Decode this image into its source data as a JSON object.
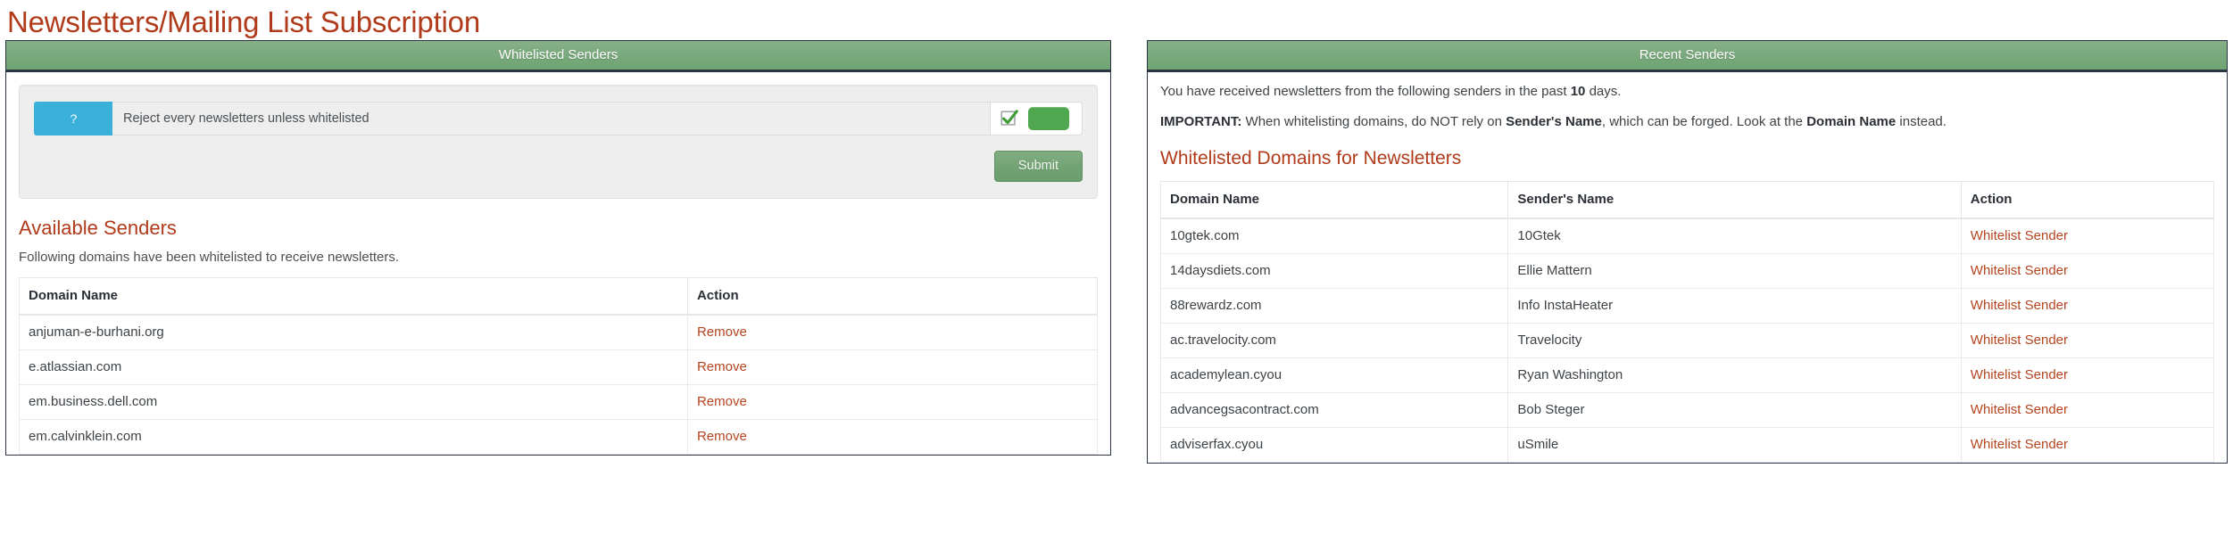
{
  "page": {
    "title": "Newsletters/Mailing List Subscription",
    "title_color": "#b03a1a"
  },
  "left_panel": {
    "heading": "Whitelisted Senders",
    "form": {
      "help_button_label": "?",
      "setting_label": "Reject every newsletters unless whitelisted",
      "tick_icon": "check-icon",
      "toggle_state_color": "#4fa74f",
      "submit_label": "Submit"
    },
    "available_senders": {
      "title": "Available Senders",
      "description": "Following domains have been whitelisted to receive newsletters.",
      "columns": [
        "Domain Name",
        "Action"
      ],
      "rows": [
        {
          "domain": "anjuman-e-burhani.org",
          "action": "Remove"
        },
        {
          "domain": "e.atlassian.com",
          "action": "Remove"
        },
        {
          "domain": "em.business.dell.com",
          "action": "Remove"
        },
        {
          "domain": "em.calvinklein.com",
          "action": "Remove"
        }
      ]
    }
  },
  "right_panel": {
    "heading": "Recent Senders",
    "intro": {
      "line1_pre": "You have received newsletters from the following senders in the past ",
      "line1_days": "10",
      "line1_post": " days.",
      "line2_label": "IMPORTANT:",
      "line2_a": " When whitelisting domains, do NOT rely on ",
      "line2_b": "Sender's Name",
      "line2_c": ", which can be forged. Look at the ",
      "line2_d": "Domain Name",
      "line2_e": " instead."
    },
    "whitelisted_domains": {
      "title": "Whitelisted Domains for Newsletters",
      "columns": [
        "Domain Name",
        "Sender's Name",
        "Action"
      ],
      "rows": [
        {
          "domain": "10gtek.com",
          "sender": "10Gtek",
          "action": "Whitelist Sender"
        },
        {
          "domain": "14daysdiets.com",
          "sender": "Ellie Mattern",
          "action": "Whitelist Sender"
        },
        {
          "domain": "88rewardz.com",
          "sender": "Info InstaHeater",
          "action": "Whitelist Sender"
        },
        {
          "domain": "ac.travelocity.com",
          "sender": "Travelocity",
          "action": "Whitelist Sender"
        },
        {
          "domain": "academylean.cyou",
          "sender": "Ryan Washington",
          "action": "Whitelist Sender"
        },
        {
          "domain": "advancegsacontract.com",
          "sender": "Bob Steger",
          "action": "Whitelist Sender"
        },
        {
          "domain": "adviserfax.cyou",
          "sender": "uSmile",
          "action": "Whitelist Sender"
        }
      ]
    }
  }
}
